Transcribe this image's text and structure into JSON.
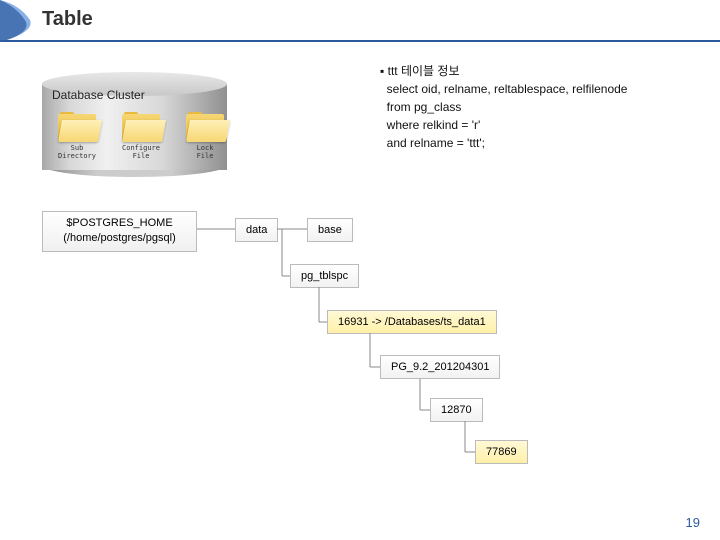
{
  "header": {
    "title": "Table"
  },
  "cluster": {
    "label": "Database Cluster",
    "folders": [
      {
        "label": "Sub\nDirectory"
      },
      {
        "label": "Configure\nFile"
      },
      {
        "label": "Lock\nFile"
      }
    ]
  },
  "info": {
    "bullet": "▪",
    "title": "ttt 테이블 정보",
    "lines": [
      "select oid, relname, reltablespace, relfilenode",
      "from pg_class",
      "where relkind = 'r'",
      "and relname = 'ttt';"
    ]
  },
  "tree": {
    "root_line1": "$POSTGRES_HOME",
    "root_line2": "(/home/postgres/pgsql)",
    "data": "data",
    "base": "base",
    "pg_tblspc": "pg_tblspc",
    "link": "16931 -> /Databases/ts_data1",
    "pgver": "PG_9.2_201204301",
    "dboid": "12870",
    "relfile": "77869"
  },
  "page": "19"
}
